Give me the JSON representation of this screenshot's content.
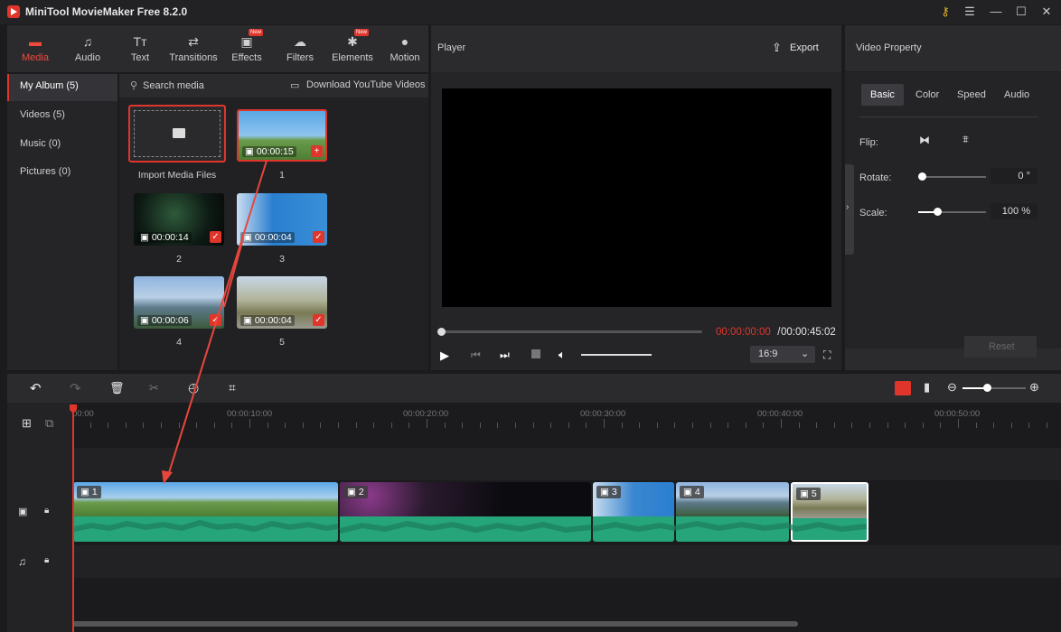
{
  "app": {
    "title": "MiniTool MovieMaker Free 8.2.0"
  },
  "topbar": {
    "tabs": [
      {
        "label": "Media",
        "icon": "folder-icon",
        "active": true
      },
      {
        "label": "Audio",
        "icon": "music-note-icon"
      },
      {
        "label": "Text",
        "icon": "text-icon"
      },
      {
        "label": "Transitions",
        "icon": "transitions-icon"
      },
      {
        "label": "Effects",
        "icon": "effects-icon",
        "badge": "New"
      },
      {
        "label": "Filters",
        "icon": "filters-icon"
      },
      {
        "label": "Elements",
        "icon": "elements-icon",
        "badge": "New"
      },
      {
        "label": "Motion",
        "icon": "motion-icon"
      }
    ]
  },
  "library": {
    "nav": [
      {
        "label": "My Album (5)",
        "active": true
      },
      {
        "label": "Videos (5)"
      },
      {
        "label": "Music (0)"
      },
      {
        "label": "Pictures (0)"
      }
    ],
    "search_placeholder": "Search media",
    "download_label": "Download YouTube Videos",
    "import_label": "Import Media Files",
    "items": [
      {
        "name": "1",
        "duration": "00:00:15"
      },
      {
        "name": "2",
        "duration": "00:00:14"
      },
      {
        "name": "3",
        "duration": "00:00:04"
      },
      {
        "name": "4",
        "duration": "00:00:06"
      },
      {
        "name": "5",
        "duration": "00:00:04"
      }
    ]
  },
  "player": {
    "title": "Player",
    "export_label": "Export",
    "current_time": "00:00:00:00",
    "separator": " / ",
    "total_time": "00:00:45:02",
    "aspect": "16:9",
    "volume_level": 0.97,
    "progress": 0
  },
  "property": {
    "title": "Video Property",
    "tabs": [
      "Basic",
      "Color",
      "Speed",
      "Audio"
    ],
    "active_tab": "Basic",
    "flip_label": "Flip:",
    "rotate_label": "Rotate:",
    "rotate_value": "0 °",
    "scale_label": "Scale:",
    "scale_value": "100 %",
    "reset_label": "Reset"
  },
  "timeline": {
    "ruler": [
      "00:00",
      "00:00:10:00",
      "00:00:20:00",
      "00:00:30:00",
      "00:00:40:00",
      "00:00:50:00"
    ],
    "clips": [
      "1",
      "2",
      "3",
      "4",
      "5"
    ]
  },
  "colors": {
    "accent": "#e0352b",
    "audio": "#26a47a"
  }
}
